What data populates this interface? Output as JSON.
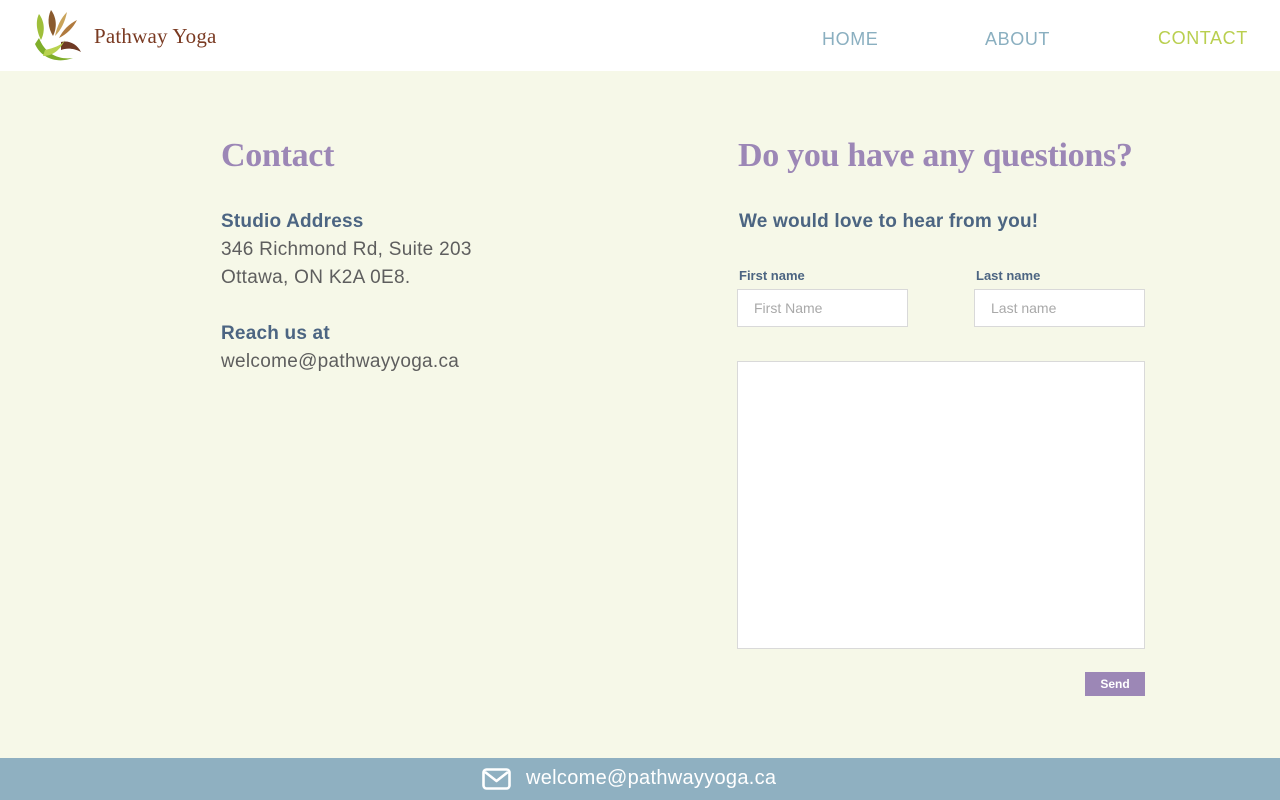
{
  "header": {
    "logo_text": "Pathway Yoga",
    "nav": {
      "home": "HOME",
      "about": "ABOUT",
      "contact": "CONTACT"
    }
  },
  "contact": {
    "title": "Contact",
    "address_heading": "Studio Address",
    "address_line1": "346 Richmond Rd, Suite 203",
    "address_line2": "Ottawa, ON K2A 0E8.",
    "reach_heading": "Reach us at",
    "email": "welcome@pathwayyoga.ca"
  },
  "form": {
    "title": "Do you have any questions?",
    "subtitle": "We would love to hear from you!",
    "first_name_label": "First name",
    "first_name_placeholder": "First Name",
    "last_name_label": "Last name",
    "last_name_placeholder": "Last name",
    "message_value": "",
    "send_label": "Send"
  },
  "footer": {
    "icon": "envelope-icon",
    "email": "welcome@pathwayyoga.ca"
  },
  "colors": {
    "page_background": "#f6f8e8",
    "heading_purple": "#9c87b6",
    "text_blue": "#4c6582",
    "nav_inactive": "#8aafc0",
    "nav_active": "#b9cf4f",
    "footer_background": "#8fb0c1"
  }
}
